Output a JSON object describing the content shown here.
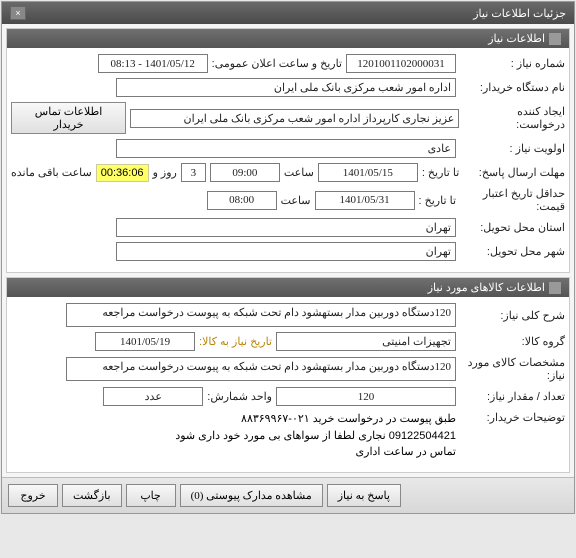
{
  "window": {
    "title": "جزئیات اطلاعات نیاز"
  },
  "section1": {
    "header": "اطلاعات نیاز",
    "fields": {
      "request_no_label": "شماره نیاز :",
      "request_no": "1201001102000031",
      "announce_label": "تاریخ و ساعت اعلان عمومی:",
      "announce_value": "1401/05/12 - 08:13",
      "buyer_label": "نام دستگاه خریدار:",
      "buyer_value": "اداره امور شعب مرکزی بانک ملی ایران",
      "creator_label": "ایجاد کننده درخواست:",
      "creator_value": "عزیز نجاری کارپرداز اداره امور شعب مرکزی بانک ملی ایران",
      "buyer_contact_btn": "اطلاعات تماس خریدار",
      "priority_label": "اولویت نیاز :",
      "priority_value": "عادی",
      "deadline_label": "مهلت ارسال پاسخ:",
      "deadline_to_label": "تا تاریخ :",
      "deadline_date": "1401/05/15",
      "time_label": "ساعت",
      "deadline_time": "09:00",
      "days_remain": "3",
      "days_text": "روز و",
      "hours_remain": "00:36:06",
      "hours_text": "ساعت باقی مانده",
      "validity_label": "حداقل تاریخ اعتبار قیمت:",
      "validity_to_label": "تا تاریخ :",
      "validity_date": "1401/05/31",
      "validity_time_label": "ساعت",
      "validity_time": "08:00",
      "province_label": "استان محل تحویل:",
      "province_value": "تهران",
      "city_label": "شهر محل تحویل:",
      "city_value": "تهران"
    }
  },
  "section2": {
    "header": "اطلاعات کالاهای مورد نیاز",
    "fields": {
      "desc_label": "شرح کلی نیاز:",
      "desc_value": "120دستگاه دوربین مدار بستهشود دام تحت شبکه به پیوست درخواست مراجعه",
      "group_label": "گروه کالا:",
      "group_value": "تجهیزات امنیتی",
      "need_date_label": "تاریخ نیاز به کالا:",
      "need_date_value": "1401/05/19",
      "spec_label": "مشخصات کالای مورد نیاز:",
      "spec_value": "120دستگاه دوربین مدار بستهشود دام تحت شبکه به پیوست درخواست مراجعه",
      "qty_label": "تعداد / مقدار نیاز:",
      "qty_value": "120",
      "unit_label": "واحد شمارش:",
      "unit_value": "عدد",
      "buyer_notes_label": "توضیحات خریدار:",
      "buyer_notes_value": "طبق پیوست در درخواست خرید ۰۲۱-۸۸۳۶۹۹۶۷\n09122504421 نجاری لطفا از سواهای بی مورد خود داری شود\nتماس در ساعت اداری"
    }
  },
  "footer": {
    "reply": "پاسخ به نیاز",
    "attachments": "مشاهده مدارک پیوستی (0)",
    "print": "چاپ",
    "back": "بازگشت",
    "exit": "خروج"
  }
}
